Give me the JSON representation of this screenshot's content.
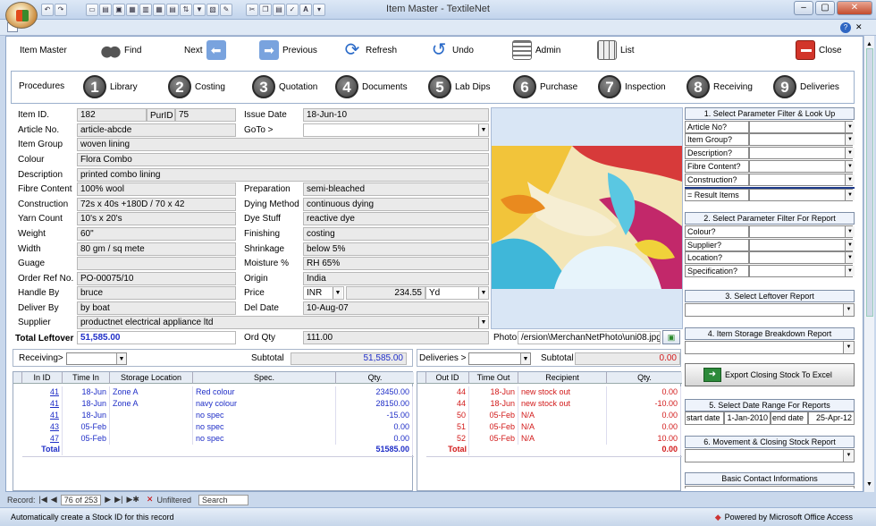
{
  "window": {
    "title": "Item Master - TextileNet"
  },
  "toolbar": {
    "title": "Item Master",
    "find": "Find",
    "next": "Next",
    "previous": "Previous",
    "refresh": "Refresh",
    "undo": "Undo",
    "admin": "Admin",
    "list": "List",
    "close": "Close"
  },
  "procedures": {
    "label": "Procedures",
    "items": [
      {
        "n": "1",
        "label": "Library"
      },
      {
        "n": "2",
        "label": "Costing"
      },
      {
        "n": "3",
        "label": "Quotation"
      },
      {
        "n": "4",
        "label": "Documents"
      },
      {
        "n": "5",
        "label": "Lab Dips"
      },
      {
        "n": "6",
        "label": "Purchase"
      },
      {
        "n": "7",
        "label": "Inspection"
      },
      {
        "n": "8",
        "label": "Receiving"
      },
      {
        "n": "9",
        "label": "Deliveries"
      }
    ]
  },
  "form": {
    "item_id_label": "Item ID.",
    "item_id": "182",
    "purid_label": "PurID",
    "purid": "75",
    "issue_date_label": "Issue Date",
    "issue_date": "18-Jun-10",
    "article_label": "Article No.",
    "article": "article-abcde",
    "goto_label": "GoTo >",
    "item_group_label": "Item Group",
    "item_group": "woven lining",
    "colour_label": "Colour",
    "colour": "Flora Combo",
    "description_label": "Description",
    "description": "printed combo lining",
    "fibre_label": "Fibre Content",
    "fibre": "100%  wool",
    "preparation_label": "Preparation",
    "preparation": "semi-bleached",
    "construction_label": "Construction",
    "construction": "72s x 40s +180D / 70 x 42",
    "dying_label": "Dying Method",
    "dying": "continuous dying",
    "yarn_label": "Yarn Count",
    "yarn": "10's x 20's",
    "dye_label": "Dye Stuff",
    "dye": "reactive dye",
    "weight_label": "Weight",
    "weight": "60\"",
    "finishing_label": "Finishing",
    "finishing": "costing",
    "width_label": "Width",
    "width": "80 gm / sq mete",
    "shrinkage_label": "Shrinkage",
    "shrinkage": "below 5%",
    "guage_label": "Guage",
    "guage": "",
    "moisture_label": "Moisture %",
    "moisture": "RH 65%",
    "order_label": "Order Ref No.",
    "order": "PO-00075/10",
    "origin_label": "Origin",
    "origin": "India",
    "handle_label": "Handle By",
    "handle": "bruce",
    "price_label": "Price",
    "currency": "INR",
    "price": "234.55",
    "unit": "Yd",
    "deliver_label": "Deliver By",
    "deliver": "by boat",
    "del_date_label": "Del Date",
    "del_date": "10-Aug-07",
    "supplier_label": "Supplier",
    "supplier": "productnet electrical appliance ltd",
    "total_leftover_label": "Total Leftover",
    "total_leftover": "51,585.00",
    "ord_qty_label": "Ord Qty",
    "ord_qty": "111.00",
    "photo_label": "Photo",
    "photo_path": "/ersion\\MerchanNetPhoto\\uni08.jpg"
  },
  "right": {
    "h1": "1. Select Parameter Filter & Look Up",
    "f1": [
      "Article No?",
      "Item Group?",
      "Description?",
      "Fibre Content?",
      "Construction?",
      "= Result Items"
    ],
    "h2": "2. Select Parameter Filter For Report",
    "f2": [
      "Colour?",
      "Supplier?",
      "Location?",
      "Specification?"
    ],
    "h3": "3. Select Leftover Report",
    "h4": "4. Item Storage Breakdown Report",
    "export": "Export Closing Stock To Excel",
    "h5": "5. Select Date Range For  Reports",
    "start_label": "start date",
    "start": "1-Jan-2010",
    "end_label": "end date",
    "end": "25-Apr-12",
    "h6": "6. Movement & Closing Stock Report",
    "h7": "Basic Contact Informations"
  },
  "receiving": {
    "label": "Receiving>",
    "subtotal_label": "Subtotal",
    "subtotal": "51,585.00",
    "cols": [
      "In ID",
      "Time In",
      "Storage Location",
      "Spec.",
      "Qty."
    ],
    "rows": [
      [
        "41",
        "18-Jun",
        "Zone A",
        "Red colour",
        "23450.00"
      ],
      [
        "41",
        "18-Jun",
        "Zone A",
        "navy colour",
        "28150.00"
      ],
      [
        "41",
        "18-Jun",
        "",
        "no spec",
        "-15.00"
      ],
      [
        "43",
        "05-Feb",
        "",
        "no spec",
        "0.00"
      ],
      [
        "47",
        "05-Feb",
        "",
        "no spec",
        "0.00"
      ]
    ],
    "total_label": "Total",
    "total": "51585.00"
  },
  "deliveries": {
    "label": "Deliveries >",
    "subtotal_label": "Subtotal",
    "subtotal": "0.00",
    "cols": [
      "Out ID",
      "Time Out",
      "Recipient",
      "Qty."
    ],
    "rows": [
      [
        "44",
        "18-Jun",
        "new stock out",
        "0.00"
      ],
      [
        "44",
        "18-Jun",
        "new stock out",
        "-10.00"
      ],
      [
        "50",
        "05-Feb",
        "N/A",
        "0.00"
      ],
      [
        "51",
        "05-Feb",
        "N/A",
        "0.00"
      ],
      [
        "52",
        "05-Feb",
        "N/A",
        "10.00"
      ]
    ],
    "total_label": "Total",
    "total": "0.00"
  },
  "nav": {
    "record_label": "Record:",
    "record": "76 of 253",
    "filter": "Unfiltered",
    "search": "Search"
  },
  "status": {
    "left": "Automatically create a Stock ID for this record",
    "right": "Powered by Microsoft Office Access"
  }
}
